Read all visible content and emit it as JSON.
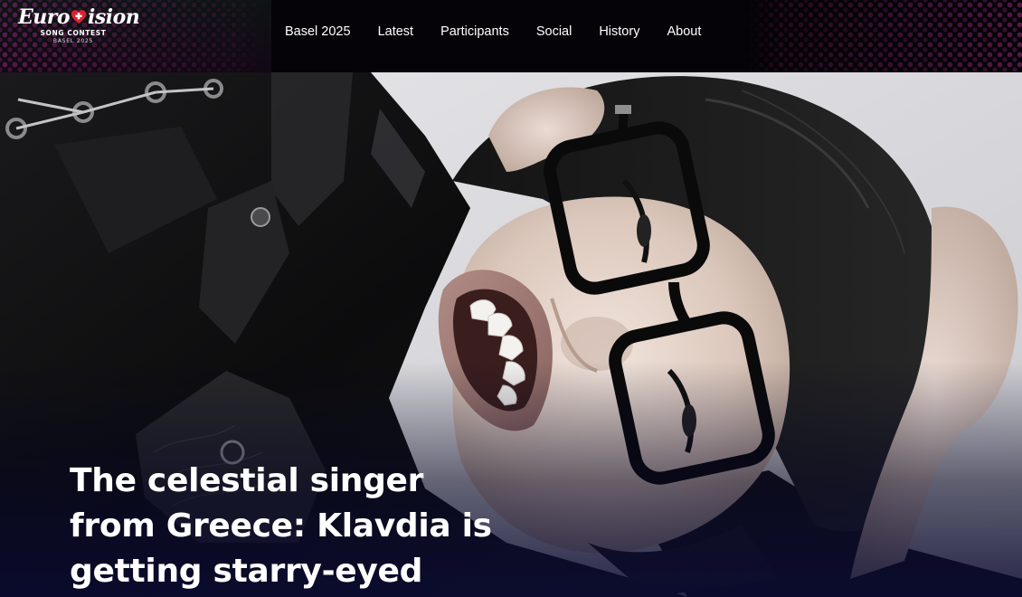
{
  "brand": {
    "name": "Eurovision",
    "subtitle": "SONG CONTEST",
    "edition": "BASEL 2025"
  },
  "nav": {
    "items": [
      {
        "label": "Basel 2025"
      },
      {
        "label": "Latest"
      },
      {
        "label": "Participants"
      },
      {
        "label": "Social"
      },
      {
        "label": "History"
      },
      {
        "label": "About"
      }
    ]
  },
  "hero": {
    "headline": "The celestial singer from Greece: Klavdia is getting starry-eyed",
    "image_icon": "artist-photo"
  },
  "colors": {
    "header_bg": "#050307",
    "heart_pattern": "#962878",
    "logo_heart": "#e0202e",
    "hero_fade": "#0a0a32",
    "text": "#ffffff"
  }
}
